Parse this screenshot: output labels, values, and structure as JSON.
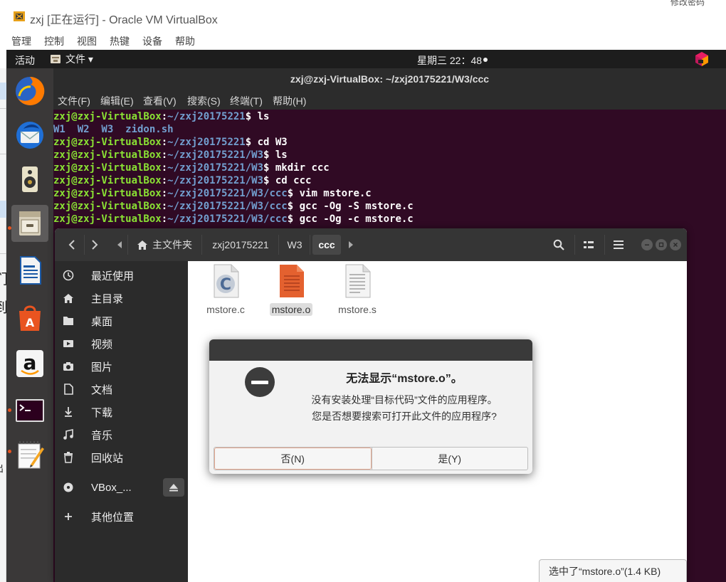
{
  "host": {
    "title": "zxj [正在运行] - Oracle VM VirtualBox",
    "menu": [
      "管理",
      "控制",
      "视图",
      "热键",
      "设备",
      "帮助"
    ],
    "corner_text": "修改密码",
    "edge_chars": [
      "们",
      "到",
      "出"
    ]
  },
  "topbar": {
    "activities": "活动",
    "app_menu": "文件 ▾",
    "clock": "星期三 22：48"
  },
  "dock": {
    "items": [
      {
        "name": "firefox"
      },
      {
        "name": "thunderbird"
      },
      {
        "name": "rhythmbox"
      },
      {
        "name": "files"
      },
      {
        "name": "libreoffice-writer"
      },
      {
        "name": "software-center"
      },
      {
        "name": "amazon"
      },
      {
        "name": "terminal"
      },
      {
        "name": "text-editor"
      }
    ]
  },
  "terminal": {
    "title": "zxj@zxj-VirtualBox: ~/zxj20175221/W3/ccc",
    "menu": [
      "文件(F)",
      "编辑(E)",
      "查看(V)",
      "搜索(S)",
      "终端(T)",
      "帮助(H)"
    ],
    "prompt_user": "zxj@zxj-VirtualBox",
    "lines": [
      {
        "path": "~/zxj20175221",
        "cmd": "ls"
      },
      {
        "output": "W1  W2  W3  zidon.sh"
      },
      {
        "path": "~/zxj20175221",
        "cmd": "cd W3"
      },
      {
        "path": "~/zxj20175221/W3",
        "cmd": "ls"
      },
      {
        "path": "~/zxj20175221/W3",
        "cmd": "mkdir ccc"
      },
      {
        "path": "~/zxj20175221/W3",
        "cmd": "cd ccc"
      },
      {
        "path": "~/zxj20175221/W3/ccc",
        "cmd": "vim mstore.c"
      },
      {
        "path": "~/zxj20175221/W3/ccc",
        "cmd": "gcc -Og -S mstore.c"
      },
      {
        "path": "~/zxj20175221/W3/ccc",
        "cmd": "gcc -Og -c mstore.c"
      }
    ]
  },
  "files": {
    "breadcrumbs": {
      "home": "主文件夹",
      "b1": "zxj20175221",
      "b2": "W3",
      "current": "ccc"
    },
    "sidebar": [
      {
        "label": "最近使用",
        "icon": "clock-icon"
      },
      {
        "label": "主目录",
        "icon": "home-icon"
      },
      {
        "label": "桌面",
        "icon": "folder-icon"
      },
      {
        "label": "视频",
        "icon": "video-icon"
      },
      {
        "label": "图片",
        "icon": "camera-icon"
      },
      {
        "label": "文档",
        "icon": "document-icon"
      },
      {
        "label": "下载",
        "icon": "download-icon"
      },
      {
        "label": "音乐",
        "icon": "music-icon"
      },
      {
        "label": "回收站",
        "icon": "trash-icon"
      },
      {
        "label": "VBox_...",
        "icon": "disc-icon"
      },
      {
        "label": "其他位置",
        "icon": "plus-icon"
      }
    ],
    "items": [
      {
        "name": "mstore.c",
        "type": "c-source"
      },
      {
        "name": "mstore.o",
        "type": "object"
      },
      {
        "name": "mstore.s",
        "type": "text"
      }
    ],
    "status": "选中了“mstore.o”(1.4 KB)"
  },
  "dialog": {
    "title": "无法显示“mstore.o”。",
    "message_line1": "没有安装处理“目标代码”文件的应用程序。",
    "message_line2": "您是否想要搜索可打开此文件的应用程序?",
    "no_label": "否(N)",
    "yes_label": "是(Y)"
  },
  "colors": {
    "terminal_bg": "#300a24",
    "prompt_user": "#8ae234",
    "prompt_path": "#729fcf",
    "ubuntu_orange": "#e95420"
  }
}
